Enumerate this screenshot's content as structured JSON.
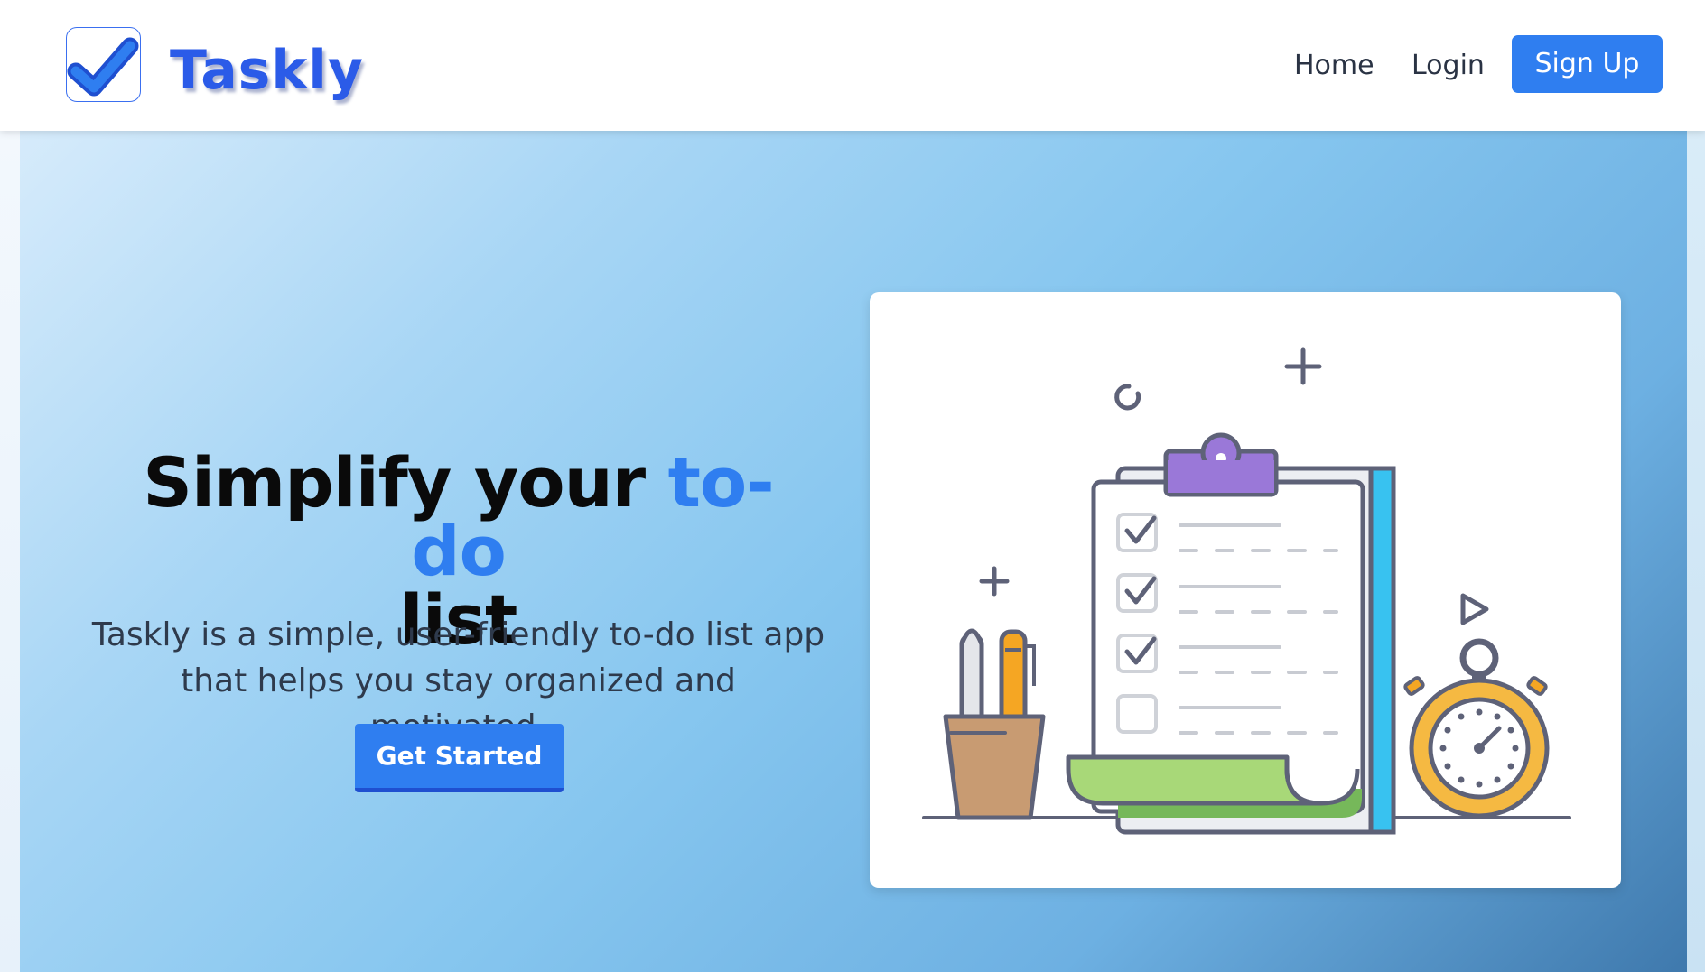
{
  "header": {
    "brand": "Taskly",
    "logo_icon": "checkmark-icon",
    "nav": {
      "home": "Home",
      "login": "Login",
      "signup": "Sign Up"
    }
  },
  "hero": {
    "headline_main": "Simplify your ",
    "headline_accent": "to-do",
    "headline_end": "list",
    "subtitle": "Taskly is a simple, user-friendly to-do list app that helps you stay organized and motivated.",
    "cta": "Get Started"
  },
  "illustration": {
    "icon": "clipboard-checklist-icon"
  },
  "colors": {
    "accent": "#2f7ef0",
    "brand": "#2b5be8",
    "headline": "#0a0a0a",
    "subtitle": "#2e3a4c"
  }
}
